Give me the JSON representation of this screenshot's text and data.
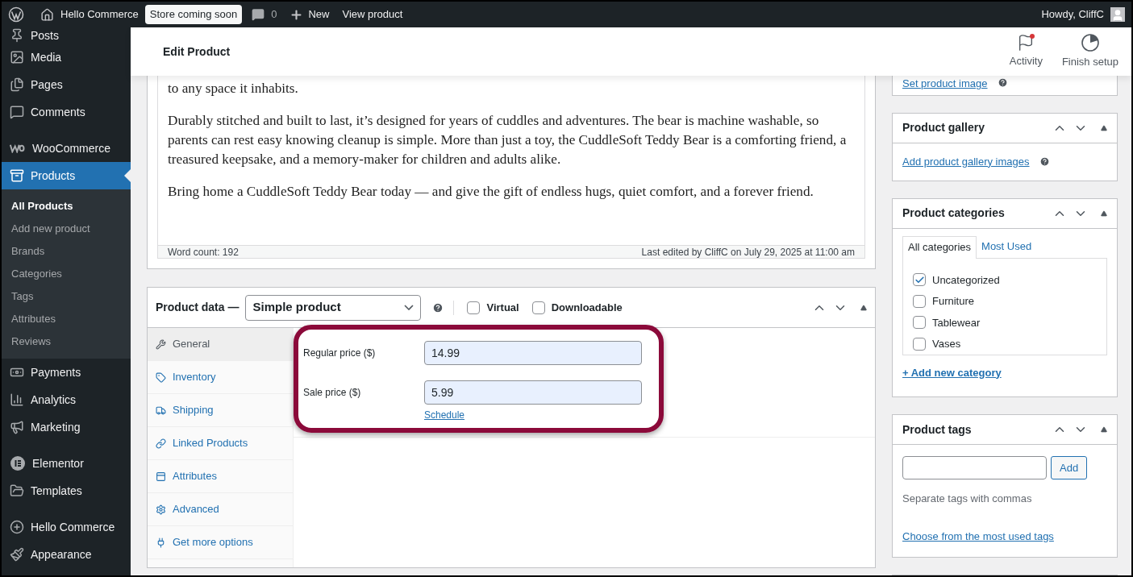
{
  "admin_bar": {
    "site": "Hello Commerce",
    "badge": "Store coming soon",
    "comments": "0",
    "new": "New",
    "view": "View product",
    "howdy": "Howdy, CliffC"
  },
  "sidebar": {
    "sections": [
      [
        {
          "label": "Posts",
          "selected": false
        },
        {
          "label": "Media",
          "selected": false
        },
        {
          "label": "Pages",
          "selected": false
        },
        {
          "label": "Comments",
          "selected": false
        }
      ],
      [
        {
          "label": "WooCommerce",
          "selected": false
        },
        {
          "label": "Products",
          "selected": true,
          "children": [
            {
              "label": "All Products",
              "selected": true
            },
            {
              "label": "Add new product",
              "selected": false
            },
            {
              "label": "Brands",
              "selected": false
            },
            {
              "label": "Categories",
              "selected": false
            },
            {
              "label": "Tags",
              "selected": false
            },
            {
              "label": "Attributes",
              "selected": false
            },
            {
              "label": "Reviews",
              "selected": false
            }
          ]
        },
        {
          "label": "Payments",
          "selected": false
        },
        {
          "label": "Analytics",
          "selected": false
        },
        {
          "label": "Marketing",
          "selected": false
        }
      ],
      [
        {
          "label": "Elementor",
          "selected": false
        },
        {
          "label": "Templates",
          "selected": false
        }
      ],
      [
        {
          "label": "Hello Commerce",
          "selected": false
        },
        {
          "label": "Appearance",
          "selected": false
        }
      ]
    ]
  },
  "header": {
    "title": "Edit Product",
    "actions": [
      {
        "label": "Activity",
        "notification": true
      },
      {
        "label": "Finish setup",
        "notification": false
      }
    ]
  },
  "editor": {
    "paragraphs": [
      "to any space it inhabits.",
      "Durably stitched and built to last, it’s designed for years of cuddles and adventures. The bear is machine washable, so parents can rest easy knowing cleanup is simple. More than just a toy, the CuddleSoft Teddy Bear is a comforting friend, a treasured keepsake, and a memory-maker for children and adults alike.",
      "Bring home a CuddleSoft Teddy Bear today — and give the gift of endless hugs, quiet comfort, and a forever friend."
    ],
    "word_count": "Word count: 192",
    "last_edited": "Last edited by CliffC on July 29, 2025 at 11:00 am"
  },
  "product_data": {
    "title": "Product data —",
    "type": "Simple product",
    "options": [
      {
        "label": "Virtual",
        "checked": false
      },
      {
        "label": "Downloadable",
        "checked": false
      }
    ],
    "tabs": [
      {
        "label": "General",
        "selected": true
      },
      {
        "label": "Inventory",
        "selected": false
      },
      {
        "label": "Shipping",
        "selected": false
      },
      {
        "label": "Linked Products",
        "selected": false
      },
      {
        "label": "Attributes",
        "selected": false
      },
      {
        "label": "Advanced",
        "selected": false
      },
      {
        "label": "Get more options",
        "selected": false
      }
    ],
    "fields": [
      {
        "label": "Regular price ($)",
        "value": "14.99"
      },
      {
        "label": "Sale price ($)",
        "value": "5.99",
        "link": "Schedule"
      }
    ]
  },
  "product_image": {
    "link": "Set product image"
  },
  "gallery": {
    "title": "Product gallery",
    "link": "Add product gallery images"
  },
  "categories": {
    "title": "Product categories",
    "tabs": [
      {
        "label": "All categories",
        "selected": true
      },
      {
        "label": "Most Used",
        "selected": false
      }
    ],
    "items": [
      {
        "label": "Uncategorized",
        "checked": true
      },
      {
        "label": "Furniture",
        "checked": false
      },
      {
        "label": "Tablewear",
        "checked": false
      },
      {
        "label": "Vases",
        "checked": false
      }
    ],
    "add_link": "+ Add new category"
  },
  "tags": {
    "title": "Product tags",
    "button": "Add",
    "hint": "Separate tags with commas",
    "link": "Choose from the most used tags"
  }
}
